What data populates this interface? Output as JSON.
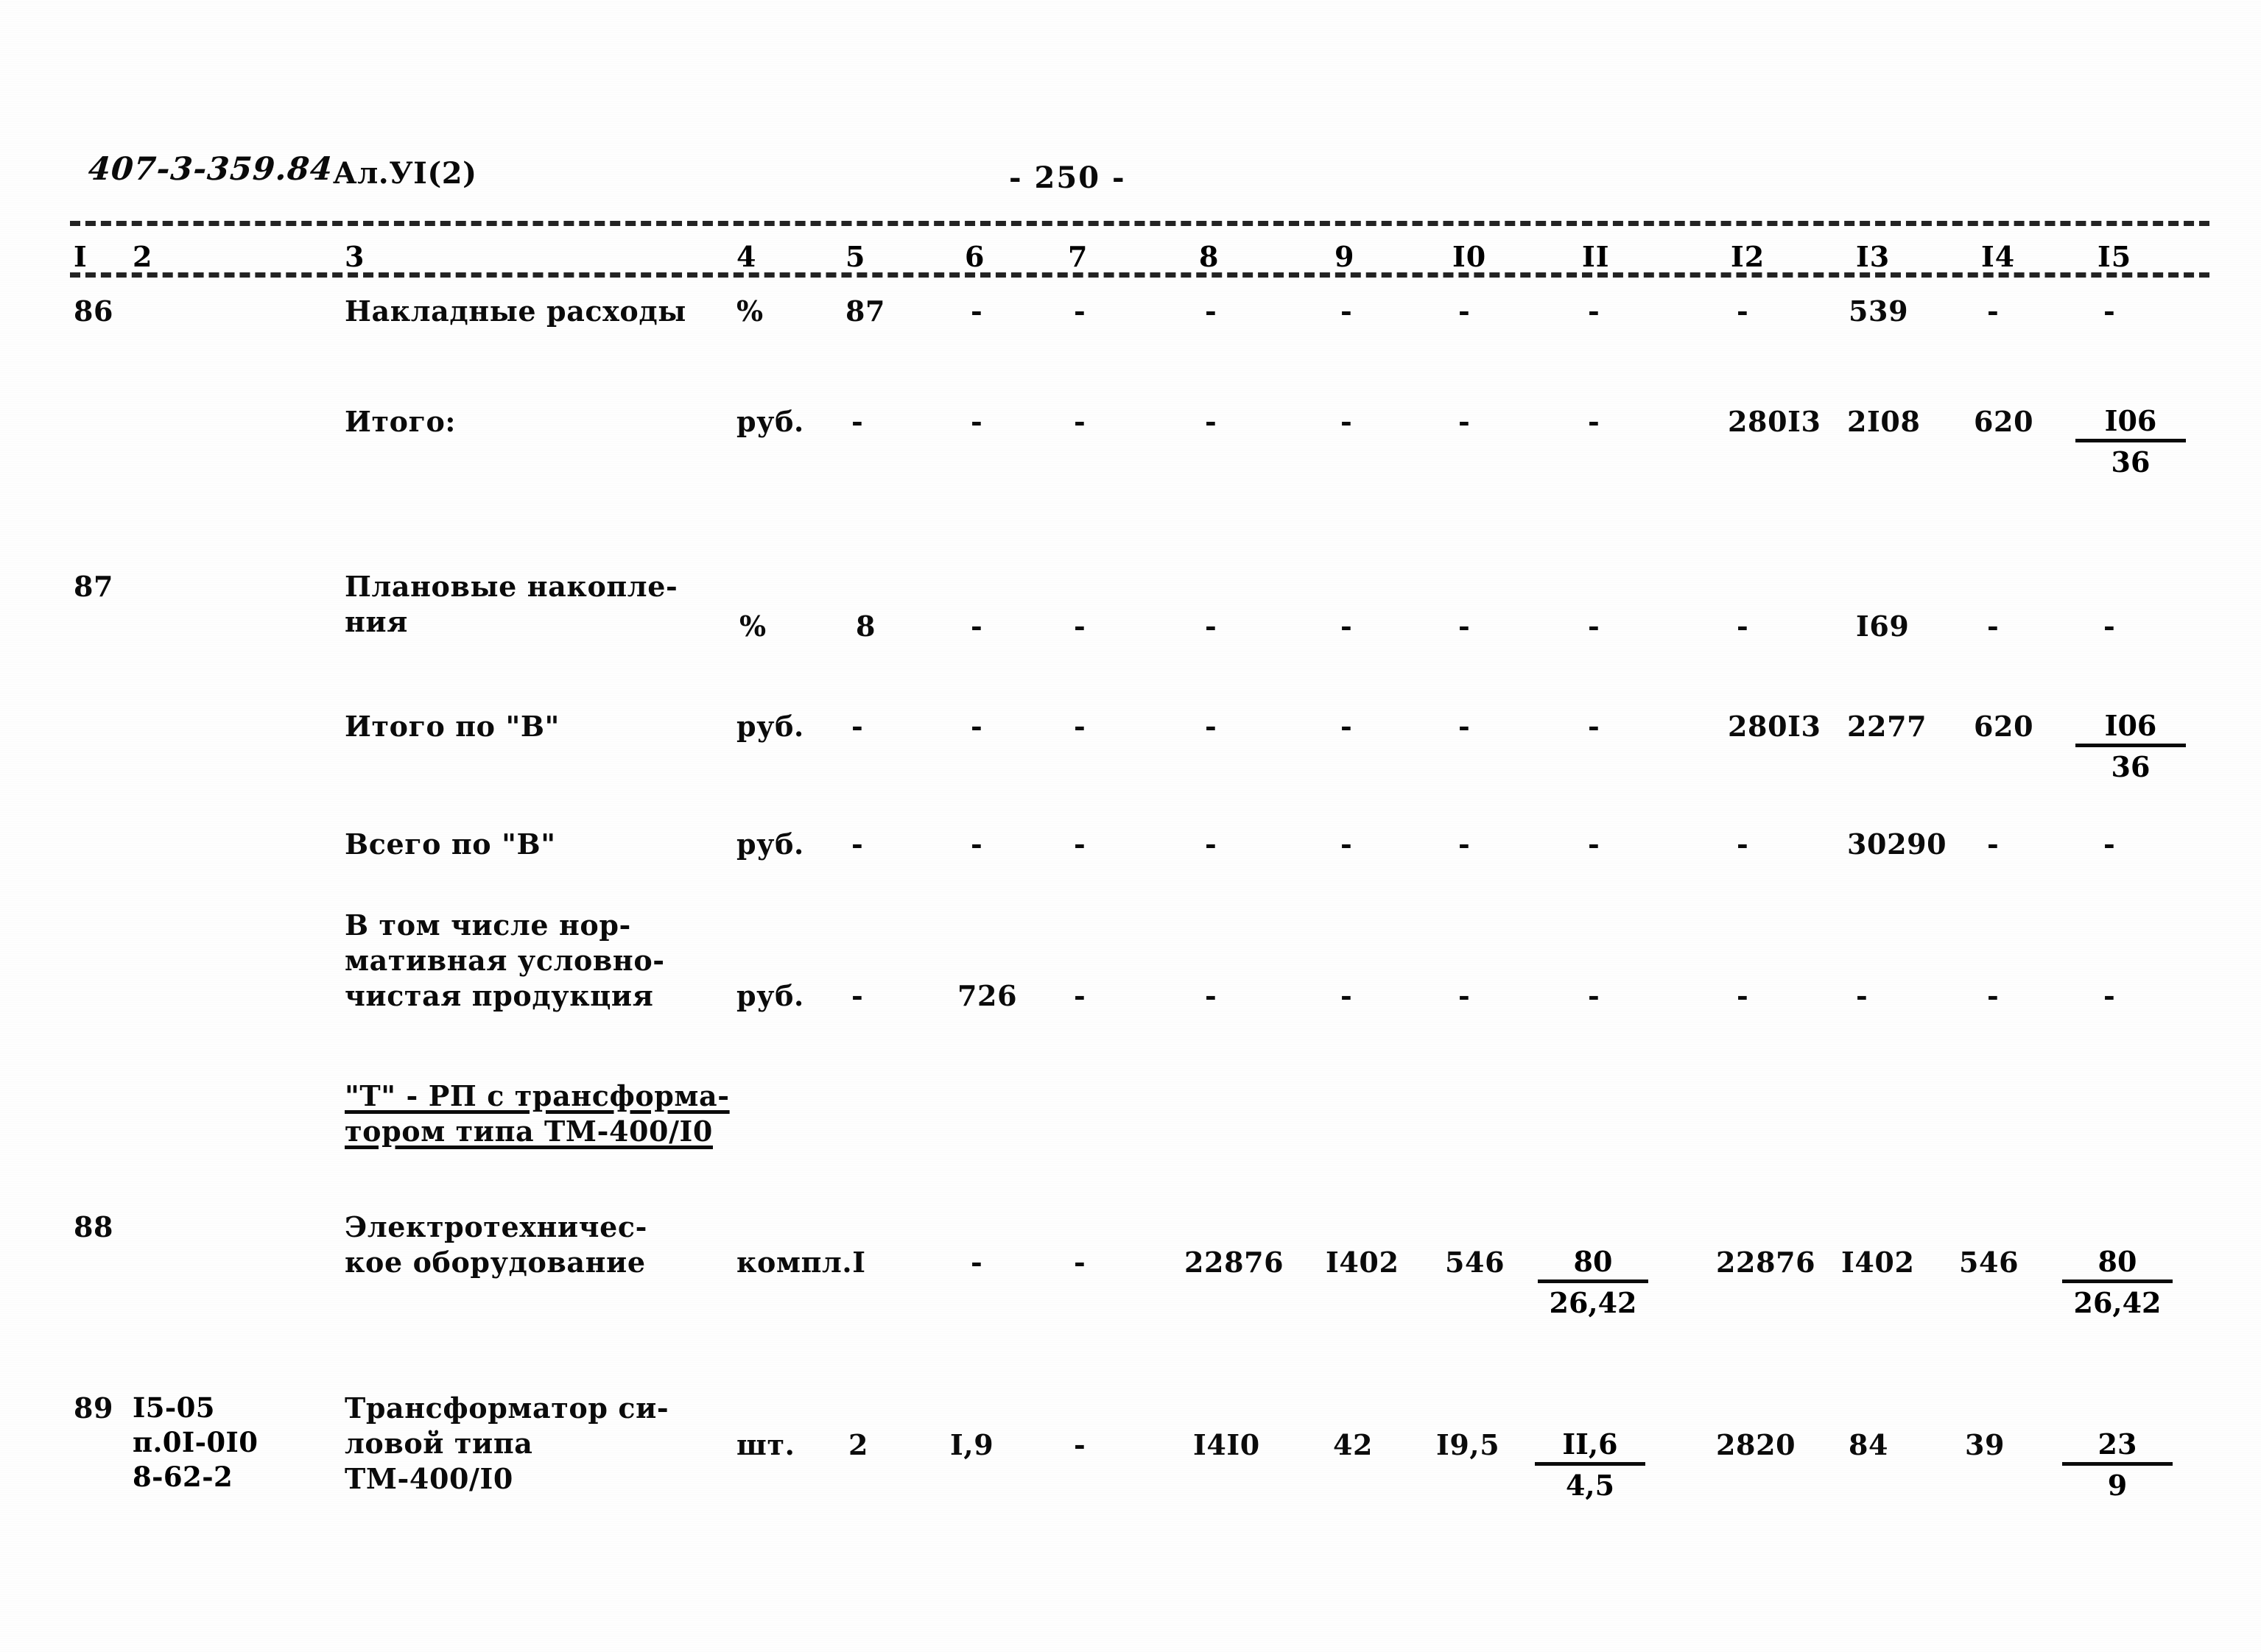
{
  "header": {
    "doc_code": "407-3-359.84",
    "album": "Ал.УI(2)",
    "page_number": "- 250 -"
  },
  "table": {
    "column_numbers": [
      "I",
      "2",
      "3",
      "4",
      "5",
      "6",
      "7",
      "8",
      "9",
      "I0",
      "II",
      "I2",
      "I3",
      "I4",
      "I5"
    ],
    "dash": "-",
    "rows": [
      {
        "no": "86",
        "code": "",
        "name": "Накладные расходы",
        "unit": "%",
        "c5": "87",
        "c6": "-",
        "c7": "-",
        "c8": "-",
        "c9": "-",
        "c10": "-",
        "c11": "-",
        "c12": "-",
        "c13": "539",
        "c14": "-",
        "c15": "-"
      },
      {
        "no": "",
        "code": "",
        "name": "Итого:",
        "unit": "руб.",
        "c5": "-",
        "c6": "-",
        "c7": "-",
        "c8": "-",
        "c9": "-",
        "c10": "-",
        "c11": "-",
        "c12": "280I3",
        "c13": "2I08",
        "c14": "620",
        "c15_num": "I06",
        "c15_den": "36"
      },
      {
        "no": "87",
        "code": "",
        "name": "Плановые накопле-\nния",
        "unit": "%",
        "c5": "8",
        "c6": "-",
        "c7": "-",
        "c8": "-",
        "c9": "-",
        "c10": "-",
        "c11": "-",
        "c12": "-",
        "c13": "I69",
        "c14": "-",
        "c15": "-"
      },
      {
        "no": "",
        "code": "",
        "name": "Итого по \"В\"",
        "unit": "руб.",
        "c5": "-",
        "c6": "-",
        "c7": "-",
        "c8": "-",
        "c9": "-",
        "c10": "-",
        "c11": "-",
        "c12": "280I3",
        "c13": "2277",
        "c14": "620",
        "c15_num": "I06",
        "c15_den": "36"
      },
      {
        "no": "",
        "code": "",
        "name": "Всего по \"В\"",
        "unit": "руб.",
        "c5": "-",
        "c6": "-",
        "c7": "-",
        "c8": "-",
        "c9": "-",
        "c10": "-",
        "c11": "-",
        "c12": "-",
        "c13": "30290",
        "c14": "-",
        "c15": "-"
      },
      {
        "no": "",
        "code": "",
        "name": "В том числе нор-\nмативная условно-\nчистая продукция",
        "unit": "руб.",
        "c5": "-",
        "c6": "726",
        "c7": "-",
        "c8": "-",
        "c9": "-",
        "c10": "-",
        "c11": "-",
        "c12": "-",
        "c13": "-",
        "c14": "-",
        "c15": "-"
      },
      {
        "no": "88",
        "code": "",
        "name": "Электротехничес-\nкое оборудование",
        "unit": "компл.I",
        "c5": "",
        "c6": "-",
        "c7": "-",
        "c8": "22876",
        "c9": "I402",
        "c10": "546",
        "c11_num": "80",
        "c11_den": "26,42",
        "c12": "22876",
        "c13": "I402",
        "c14": "546",
        "c15_num": "80",
        "c15_den": "26,42"
      },
      {
        "no": "89",
        "code": "I5-05\nп.0I-0I0\n8-62-2",
        "name": "Трансформатор си-\nловой типа\nТМ-400/I0",
        "unit": "шт.",
        "c5": "2",
        "c6": "I,9",
        "c7": "-",
        "c8": "I4I0",
        "c9": "42",
        "c10": "I9,5",
        "c11_num": "II,6",
        "c11_den": "4,5",
        "c12": "2820",
        "c13": "84",
        "c14": "39",
        "c15_num": "23",
        "c15_den": "9"
      }
    ],
    "section_heading": "\"Т\" - РП с трансформа-\nтором типа ТМ-400/I0"
  }
}
